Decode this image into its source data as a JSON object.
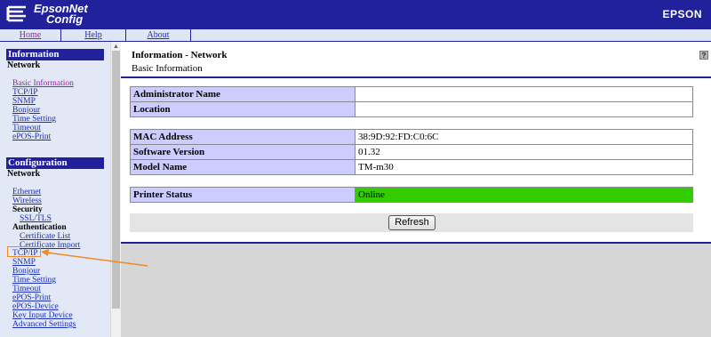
{
  "header": {
    "logo_line1": "EpsonNet",
    "logo_line2": "Config",
    "brand": "EPSON"
  },
  "topnav": {
    "home": "Home",
    "help": "Help",
    "about": "About"
  },
  "sidebar": {
    "information": {
      "title": "Information",
      "subtitle": "Network",
      "items": [
        "Basic Information",
        "TCP/IP",
        "SNMP",
        "Bonjour",
        "Time Setting",
        "Timeout",
        "ePOS-Print"
      ]
    },
    "configuration": {
      "title": "Configuration",
      "subtitle": "Network",
      "ethernet": "Ethernet",
      "wireless": "Wireless",
      "security_label": "Security",
      "ssl_tls": "SSL/TLS",
      "authentication_label": "Authentication",
      "certificate_list": "Certificate List",
      "certificate_import": "Certificate Import",
      "items_after": [
        "TCP/IP",
        "SNMP",
        "Bonjour",
        "Time Setting",
        "Timeout",
        "ePOS-Print",
        "ePOS-Device",
        "Key Input Device",
        "Advanced Settings"
      ]
    }
  },
  "main": {
    "title": "Information - Network",
    "subtitle": "Basic Information",
    "help_icon": "?",
    "table1": [
      {
        "label": "Administrator Name",
        "value": ""
      },
      {
        "label": "Location",
        "value": ""
      }
    ],
    "table2": [
      {
        "label": "MAC Address",
        "value": "38:9D:92:FD:C0:6C"
      },
      {
        "label": "Software Version",
        "value": "01.32"
      },
      {
        "label": "Model Name",
        "value": "TM-m30"
      }
    ],
    "table3": [
      {
        "label": "Printer Status",
        "value": "Online"
      }
    ],
    "refresh_label": "Refresh"
  },
  "colors": {
    "banner": "#21219c",
    "table_label_bg": "#ccccff",
    "status_online": "#33cc00",
    "annotation": "#f08a24"
  }
}
